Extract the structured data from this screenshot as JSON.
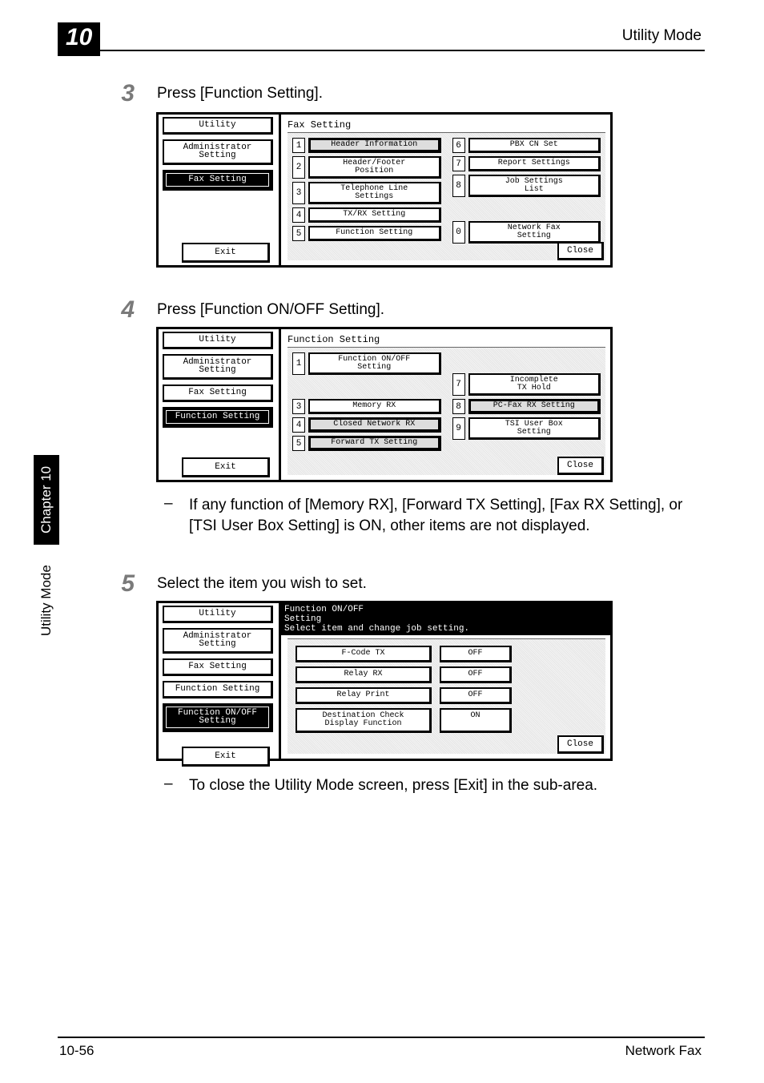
{
  "header": {
    "chapter": "10",
    "title": "Utility Mode"
  },
  "sidetabs": {
    "chapter": "Chapter 10",
    "mode": "Utility Mode"
  },
  "steps": {
    "s3": {
      "num": "3",
      "text": "Press [Function Setting]."
    },
    "s4": {
      "num": "4",
      "text": "Press [Function ON/OFF Setting]."
    },
    "s5": {
      "num": "5",
      "text": "Select the item you wish to set."
    }
  },
  "notes": {
    "after4": "If any function of [Memory RX], [Forward TX Setting], [Fax RX Setting], or [TSI User Box Setting] is ON, other items are not displayed.",
    "after5": "To close the Utility Mode screen, press [Exit] in the sub-area."
  },
  "common": {
    "exit": "Exit",
    "close": "Close"
  },
  "panel1": {
    "crumbs": {
      "utility": "Utility",
      "admin": "Administrator\nSetting",
      "fax": "Fax Setting"
    },
    "title": "Fax Setting",
    "left": [
      {
        "n": "1",
        "t": "Header Information"
      },
      {
        "n": "2",
        "t": "Header/Footer\nPosition"
      },
      {
        "n": "3",
        "t": "Telephone Line\nSettings"
      },
      {
        "n": "4",
        "t": "TX/RX Setting"
      },
      {
        "n": "5",
        "t": "Function Setting"
      }
    ],
    "right": [
      {
        "n": "6",
        "t": "PBX CN Set"
      },
      {
        "n": "7",
        "t": "Report Settings"
      },
      {
        "n": "8",
        "t": "Job Settings\nList"
      },
      {
        "n": "0",
        "t": "Network Fax\nSetting"
      }
    ]
  },
  "panel2": {
    "crumbs": {
      "utility": "Utility",
      "admin": "Administrator\nSetting",
      "fax": "Fax Setting",
      "func": "Function Setting"
    },
    "title": "Function Setting",
    "left": [
      {
        "n": "1",
        "t": "Function ON/OFF\nSetting"
      },
      {
        "n": "3",
        "t": "Memory RX"
      },
      {
        "n": "4",
        "t": "Closed Network RX"
      },
      {
        "n": "5",
        "t": "Forward TX Setting"
      }
    ],
    "right": [
      {
        "n": "7",
        "t": "Incomplete\nTX Hold"
      },
      {
        "n": "8",
        "t": "PC-Fax RX Setting"
      },
      {
        "n": "9",
        "t": "TSI User Box\nSetting"
      }
    ]
  },
  "panel3": {
    "crumbs": {
      "utility": "Utility",
      "admin": "Administrator\nSetting",
      "fax": "Fax Setting",
      "func": "Function Setting",
      "onoff": "Function ON/OFF\nSetting"
    },
    "title": "Function ON/OFF\nSetting",
    "subtitle": "Select item and change job setting.",
    "rows": [
      {
        "label": "F-Code TX",
        "val": "OFF"
      },
      {
        "label": "Relay RX",
        "val": "OFF"
      },
      {
        "label": "Relay Print",
        "val": "OFF"
      },
      {
        "label": "Destination Check\nDisplay Function",
        "val": "ON"
      }
    ]
  },
  "footer": {
    "page": "10-56",
    "doc": "Network Fax"
  }
}
